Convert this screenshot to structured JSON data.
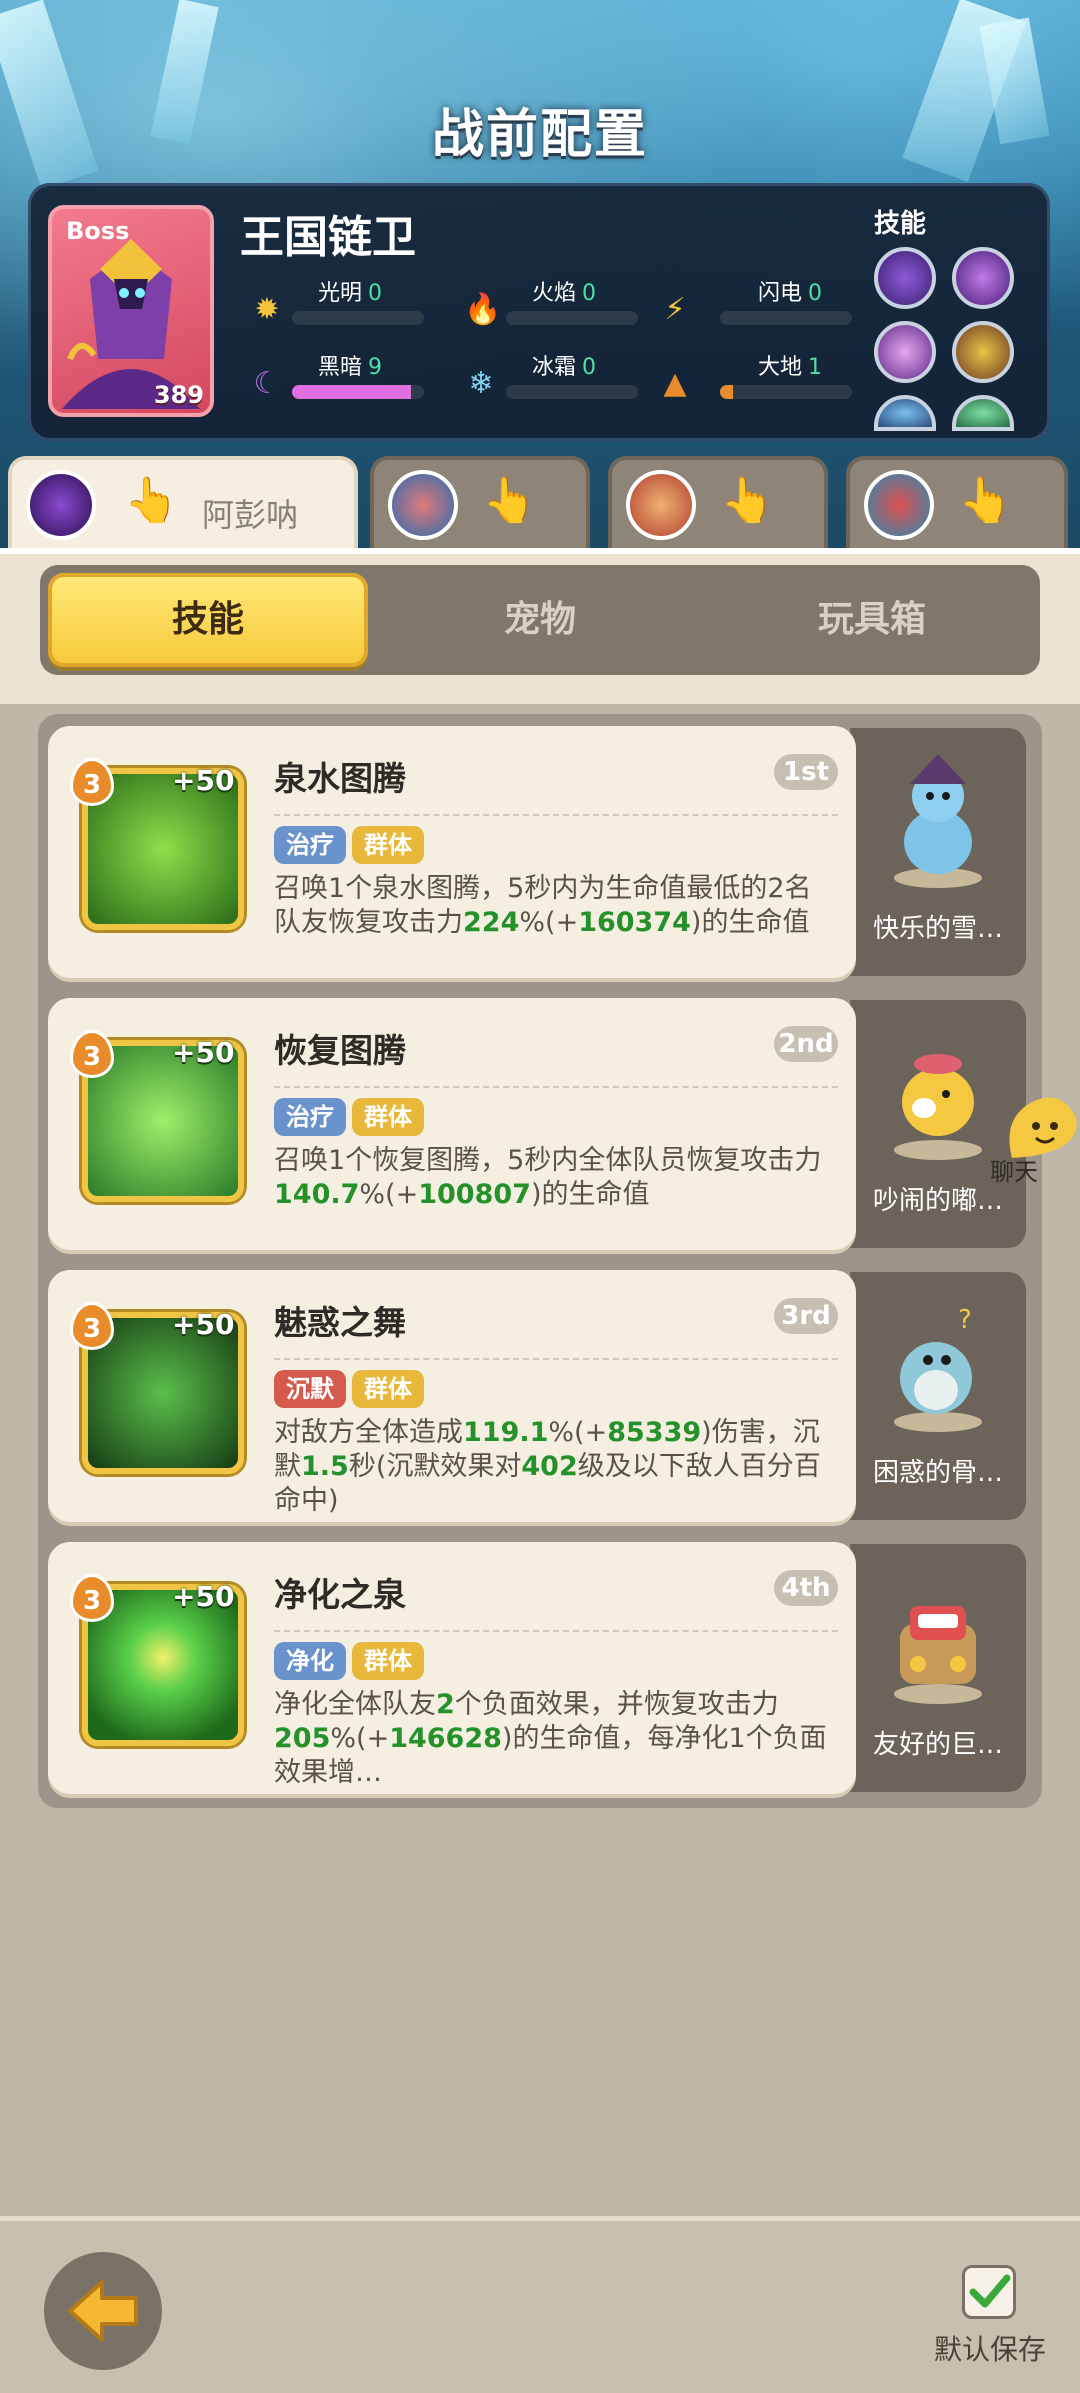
{
  "header": {
    "title": "战前配置"
  },
  "boss": {
    "tag": "Boss",
    "name": "王国链卫",
    "level": "389",
    "skills_label": "技能",
    "elements": [
      {
        "label": "光明",
        "value": "0",
        "icon": "sun-icon",
        "level": 0
      },
      {
        "label": "火焰",
        "value": "0",
        "icon": "flame-icon",
        "level": 0
      },
      {
        "label": "闪电",
        "value": "0",
        "icon": "lightning-icon",
        "level": 0
      },
      {
        "label": "黑暗",
        "value": "9",
        "icon": "moon-icon",
        "level": 9
      },
      {
        "label": "冰霜",
        "value": "0",
        "icon": "snowflake-icon",
        "level": 0
      },
      {
        "label": "大地",
        "value": "1",
        "icon": "mountain-icon",
        "level": 1
      }
    ]
  },
  "characters": [
    {
      "name": "阿彭呐",
      "active": true
    },
    {
      "name": "",
      "active": false
    },
    {
      "name": "",
      "active": false
    },
    {
      "name": "",
      "active": false
    }
  ],
  "tabs": [
    {
      "label": "技能",
      "active": true
    },
    {
      "label": "宠物",
      "active": false
    },
    {
      "label": "玩具箱",
      "active": false
    }
  ],
  "skills": [
    {
      "level": "3",
      "bonus": "+50",
      "name": "泉水图腾",
      "rank": "1st",
      "tags": [
        {
          "label": "治疗",
          "color": "#6a93cc"
        },
        {
          "label": "群体",
          "color": "#e8b83a"
        }
      ],
      "desc_parts": [
        {
          "text": "召唤1个泉水图腾，5秒内为生命值最低的2名队友恢复攻击力",
          "hl": false
        },
        {
          "text": "224",
          "hl": true
        },
        {
          "text": "%(+",
          "hl": false
        },
        {
          "text": "160374",
          "hl": true
        },
        {
          "text": ")的生命值",
          "hl": false
        }
      ],
      "pet_name": "快乐的雪…"
    },
    {
      "level": "3",
      "bonus": "+50",
      "name": "恢复图腾",
      "rank": "2nd",
      "tags": [
        {
          "label": "治疗",
          "color": "#6a93cc"
        },
        {
          "label": "群体",
          "color": "#e8b83a"
        }
      ],
      "desc_parts": [
        {
          "text": "召唤1个恢复图腾，5秒内全体队员恢复攻击力",
          "hl": false
        },
        {
          "text": "140.7",
          "hl": true
        },
        {
          "text": "%(+",
          "hl": false
        },
        {
          "text": "100807",
          "hl": true
        },
        {
          "text": ")的生命值",
          "hl": false
        }
      ],
      "pet_name": "吵闹的嘟…"
    },
    {
      "level": "3",
      "bonus": "+50",
      "name": "魅惑之舞",
      "rank": "3rd",
      "tags": [
        {
          "label": "沉默",
          "color": "#d45a4c"
        },
        {
          "label": "群体",
          "color": "#e8b83a"
        }
      ],
      "desc_parts": [
        {
          "text": "对敌方全体造成",
          "hl": false
        },
        {
          "text": "119.1",
          "hl": true
        },
        {
          "text": "%(+",
          "hl": false
        },
        {
          "text": "85339",
          "hl": true
        },
        {
          "text": ")伤害，沉默",
          "hl": false
        },
        {
          "text": "1.5",
          "hl": true
        },
        {
          "text": "秒(沉默效果对",
          "hl": false
        },
        {
          "text": "402",
          "hl": true
        },
        {
          "text": "级及以下敌人百分百命中)",
          "hl": false
        }
      ],
      "pet_name": "困惑的骨…"
    },
    {
      "level": "3",
      "bonus": "+50",
      "name": "净化之泉",
      "rank": "4th",
      "tags": [
        {
          "label": "净化",
          "color": "#6a93cc"
        },
        {
          "label": "群体",
          "color": "#e8b83a"
        }
      ],
      "desc_parts": [
        {
          "text": "净化全体队友",
          "hl": false
        },
        {
          "text": "2",
          "hl": true
        },
        {
          "text": "个负面效果，并恢复攻击力",
          "hl": false
        },
        {
          "text": "205",
          "hl": true
        },
        {
          "text": "%(+",
          "hl": false
        },
        {
          "text": "146628",
          "hl": true
        },
        {
          "text": ")的生命值，每净化1个负面效果增…",
          "hl": false
        }
      ],
      "pet_name": "友好的巨…"
    }
  ],
  "chat": {
    "label": "聊天"
  },
  "footer": {
    "save_label": "默认保存"
  },
  "colors": {
    "accent": "#f7c93a",
    "heal_tag": "#6a93cc",
    "group_tag": "#e8b83a",
    "silence_tag": "#d45a4c",
    "highlight": "#24912a"
  }
}
